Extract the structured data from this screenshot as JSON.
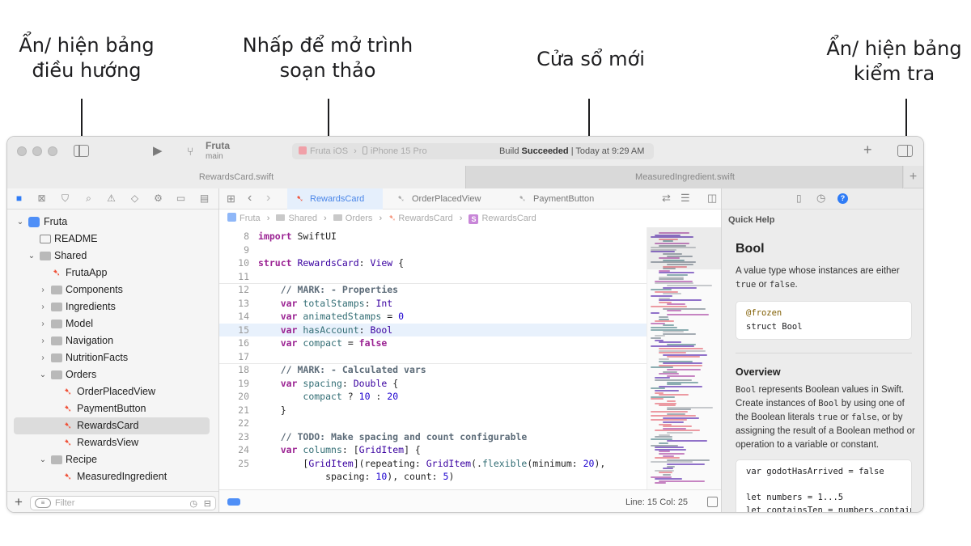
{
  "callouts": {
    "navigator": [
      "Ẩn/ hiện bảng",
      "điều hướng"
    ],
    "editor": [
      "Nhấp để mở trình",
      "soạn thảo"
    ],
    "new_window": [
      "Cửa sổ mới"
    ],
    "inspector": [
      "Ẩn/ hiện bảng",
      "kiểm tra"
    ]
  },
  "toolbar": {
    "project_name": "Fruta",
    "branch": "main",
    "scheme": "Fruta iOS",
    "device": "iPhone 15 Pro",
    "build_status_prefix": "Build",
    "build_status_bold": "Succeeded",
    "build_status_time": "| Today at 9:29 AM",
    "add_label": "+"
  },
  "window_tabs": [
    {
      "label": "RewardsCard.swift"
    },
    {
      "label": "MeasuredIngredient.swift"
    }
  ],
  "window_tab_add": "+",
  "navigator": {
    "items": [
      {
        "label": "Fruta",
        "chevron": "⌄",
        "icon": "app",
        "depth": 0
      },
      {
        "label": "README",
        "chevron": "",
        "icon": "book",
        "depth": 1
      },
      {
        "label": "Shared",
        "chevron": "⌄",
        "icon": "folder",
        "depth": 1
      },
      {
        "label": "FrutaApp",
        "chevron": "",
        "icon": "swift",
        "depth": 2
      },
      {
        "label": "Components",
        "chevron": "›",
        "icon": "folder",
        "depth": 2
      },
      {
        "label": "Ingredients",
        "chevron": "›",
        "icon": "folder",
        "depth": 2
      },
      {
        "label": "Model",
        "chevron": "›",
        "icon": "folder",
        "depth": 2
      },
      {
        "label": "Navigation",
        "chevron": "›",
        "icon": "folder",
        "depth": 2
      },
      {
        "label": "NutritionFacts",
        "chevron": "›",
        "icon": "folder",
        "depth": 2
      },
      {
        "label": "Orders",
        "chevron": "⌄",
        "icon": "folder",
        "depth": 2
      },
      {
        "label": "OrderPlacedView",
        "chevron": "",
        "icon": "swift",
        "depth": 3
      },
      {
        "label": "PaymentButton",
        "chevron": "",
        "icon": "swift",
        "depth": 3
      },
      {
        "label": "RewardsCard",
        "chevron": "",
        "icon": "swift",
        "depth": 3,
        "selected": true
      },
      {
        "label": "RewardsView",
        "chevron": "",
        "icon": "swift",
        "depth": 3
      },
      {
        "label": "Recipe",
        "chevron": "⌄",
        "icon": "folder",
        "depth": 2
      },
      {
        "label": "MeasuredIngredient",
        "chevron": "",
        "icon": "swift",
        "depth": 3
      }
    ],
    "filter_placeholder": "Filter",
    "add_label": "+"
  },
  "editor": {
    "tabs": [
      {
        "label": "RewardsCard",
        "active": true
      },
      {
        "label": "OrderPlacedView",
        "active": false
      },
      {
        "label": "PaymentButton",
        "active": false
      }
    ],
    "breadcrumb": [
      "Fruta",
      "Shared",
      "Orders",
      "RewardsCard",
      "RewardsCard"
    ],
    "current_line": 15,
    "lines": [
      {
        "n": "8",
        "code": "<span class='kw'>import</span> SwiftUI"
      },
      {
        "n": "9",
        "code": ""
      },
      {
        "n": "10",
        "code": "<span class='kw'>struct</span> <span class='ty'>RewardsCard</span>: <span class='ty'>View</span> {"
      },
      {
        "n": "11",
        "code": ""
      },
      {
        "n": "12",
        "code": "    <span class='cm'>// MARK: - Properties</span>"
      },
      {
        "n": "13",
        "code": "    <span class='kw'>var</span> <span class='id'>totalStamps</span>: <span class='ty'>Int</span>"
      },
      {
        "n": "14",
        "code": "    <span class='kw'>var</span> <span class='id'>animatedStamps</span> = <span class='nm'>0</span>"
      },
      {
        "n": "15",
        "code": "    <span class='kw'>var</span> <span class='id'>hasAccount</span>: <span class='ty'>Bool</span>"
      },
      {
        "n": "16",
        "code": "    <span class='kw'>var</span> <span class='id'>compact</span> = <span class='kw'>false</span>"
      },
      {
        "n": "17",
        "code": ""
      },
      {
        "n": "18",
        "code": "    <span class='cm'>// MARK: - Calculated vars</span>"
      },
      {
        "n": "19",
        "code": "    <span class='kw'>var</span> <span class='id'>spacing</span>: <span class='ty'>Double</span> {"
      },
      {
        "n": "20",
        "code": "        <span class='id'>compact</span> ? <span class='nm'>10</span> : <span class='nm'>20</span>"
      },
      {
        "n": "21",
        "code": "    }"
      },
      {
        "n": "22",
        "code": ""
      },
      {
        "n": "23",
        "code": "    <span class='cm'>// TODO: Make spacing and count configurable</span>"
      },
      {
        "n": "24",
        "code": "    <span class='kw'>var</span> <span class='id'>columns</span>: [<span class='ty'>GridItem</span>] {"
      },
      {
        "n": "25",
        "code": "        [<span class='ty'>GridItem</span>](repeating: <span class='ty'>GridItem</span>(.<span class='id'>flexible</span>(minimum: <span class='nm'>20</span>),"
      },
      {
        "n": "",
        "code": "            spacing: <span class='nm'>10</span>), count: <span class='nm'>5</span>)"
      }
    ],
    "status_position": "Line: 15  Col: 25"
  },
  "inspector": {
    "section_title": "Quick Help",
    "symbol": "Bool",
    "summary_pre": "A value type whose instances are either ",
    "summary_true": "true",
    "summary_mid": " or ",
    "summary_false": "false",
    "summary_post": ".",
    "declaration_attr": "@frozen",
    "declaration": "struct Bool",
    "overview_title": "Overview",
    "overview_p1a": "Bool",
    "overview_p1b": " represents Boolean values in Swift. Create instances of ",
    "overview_p1c": "Bool",
    "overview_p1d": " by using one of the Boolean literals ",
    "overview_p1e": "true",
    "overview_p1f": " or ",
    "overview_p1g": "false",
    "overview_p1h": ", or by assigning the result of a Boolean method or operation to a variable or constant.",
    "example_line1": "var godotHasArrived = false",
    "example_line2": "let numbers = 1...5",
    "example_line3": "let containsTen = numbers.contains"
  },
  "colors": {
    "accent": "#2f7cf6",
    "swift_icon": "#f05138",
    "keyword": "#9b2393"
  }
}
